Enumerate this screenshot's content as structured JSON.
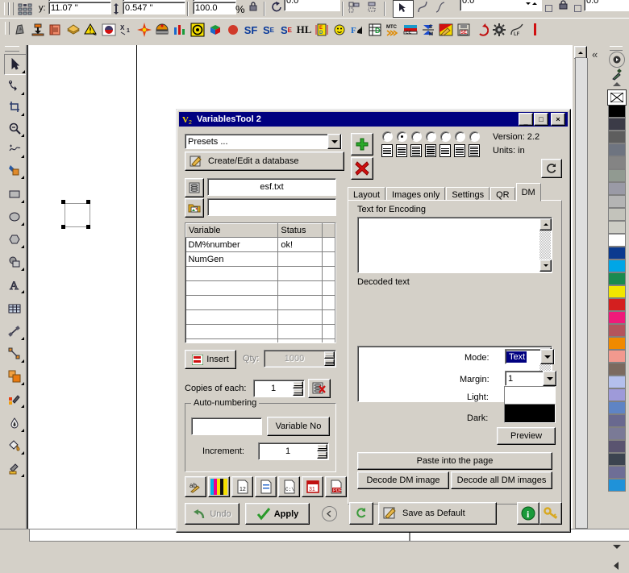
{
  "propertybar": {
    "y_label": "y:",
    "y_value": "11.07 \"",
    "height_value": "0.547 \"",
    "scale_value": "100.0",
    "percent_label": "%",
    "rotate_value": "0.0",
    "outline_value": "0.0 \"",
    "nudge_value": "0.0 \"",
    "icons": [
      "position-grid-icon",
      "height-icon",
      "lock-ratio-icon",
      "rotate-icon",
      "align-icon",
      "distribute-icon",
      "pick-tool-icon",
      "curve-icon",
      "line-icon"
    ]
  },
  "toolbar_icons": [
    "import-icon",
    "export-icon",
    "duplicate-icon",
    "package-icon",
    "warning-icon",
    "red-ball-icon",
    "transform-icon",
    "starburst-icon",
    "barcode-icon",
    "chart-icon",
    "target-icon",
    "cube-icon",
    "circle-icon",
    "sf-icon",
    "sf-grid-icon",
    "sf-mark-icon",
    "hl-icon",
    "ed-icon",
    "smiley-icon",
    "fd-icon",
    "table-d-icon",
    "mtc-icon",
    "cc-icon",
    "sm-icon",
    "pen-yellow-icon",
    "se-save-icon",
    "undo-red-icon",
    "gear-icon",
    "lf-curve-icon"
  ],
  "toolbox": [
    {
      "name": "pick-tool",
      "selected": true
    },
    {
      "name": "shape-tool",
      "selected": false
    },
    {
      "name": "crop-tool",
      "selected": false
    },
    {
      "name": "zoom-tool",
      "selected": false
    },
    {
      "name": "freehand-tool",
      "selected": false
    },
    {
      "name": "smart-fill-tool",
      "selected": false
    },
    {
      "name": "rectangle-tool",
      "selected": false
    },
    {
      "name": "ellipse-tool",
      "selected": false
    },
    {
      "name": "polygon-tool",
      "selected": false
    },
    {
      "name": "shapes-tool",
      "selected": false
    },
    {
      "name": "text-tool",
      "selected": false
    },
    {
      "name": "table-tool",
      "selected": false
    },
    {
      "name": "dimension-tool",
      "selected": false
    },
    {
      "name": "connector-tool",
      "selected": false
    },
    {
      "name": "blend-tool",
      "selected": false
    },
    {
      "name": "color-eyedropper-tool",
      "selected": false
    },
    {
      "name": "outline-tool",
      "selected": false
    },
    {
      "name": "fill-tool",
      "selected": false
    },
    {
      "name": "interactive-fill-tool",
      "selected": false
    }
  ],
  "palette": {
    "none_label": "X",
    "colors": [
      "#000000",
      "#3b3b47",
      "#5e5e5e",
      "#6e7480",
      "#848484",
      "#919a91",
      "#9a9aa6",
      "#b4b4b4",
      "#c3c3bb",
      "#cdcdc5",
      "#ffffff",
      "#0b3a8f",
      "#00a6e6",
      "#1a8a4f",
      "#f2e600",
      "#d41f1f",
      "#ef1a7a",
      "#b4545c",
      "#f08a00",
      "#f2998e",
      "#7b6a5f",
      "#b4c0ec",
      "#9e9ad9",
      "#5f84c4",
      "#69698f",
      "#7a7a96",
      "#5a5470",
      "#3c4450",
      "#6e6e96",
      "#1f92d9"
    ]
  },
  "dialog": {
    "title": "VariablesTool 2",
    "app_icon": "v2-icon",
    "minimize_label": "_",
    "maximize_label": "□",
    "close_label": "×",
    "presets_value": "Presets ...",
    "create_edit_label": "Create/Edit a database",
    "database_file": "esf.txt",
    "image_folder": "",
    "version_label": "Version: 2.2",
    "units_label": "Units:  in",
    "add_button": "+",
    "remove_button": "×",
    "refresh_icon": "refresh-icon",
    "layout_options_count": 7,
    "layout_selected_index": 1,
    "table": {
      "headers": [
        "Variable",
        "Status",
        ""
      ],
      "rows": [
        [
          "DM%number",
          "ok!",
          ""
        ],
        [
          "NumGen",
          "",
          ""
        ],
        [
          "",
          "",
          ""
        ],
        [
          "",
          "",
          ""
        ],
        [
          "",
          "",
          ""
        ],
        [
          "",
          "",
          ""
        ],
        [
          "",
          "",
          ""
        ],
        [
          "",
          "",
          ""
        ]
      ]
    },
    "insert_label": "Insert",
    "qty_label": "Qty:",
    "qty_value": "1000",
    "copies_label": "Copies of each:",
    "copies_value": "1",
    "clear_db_icon": "clear-database-icon",
    "autonumber_group": "Auto-numbering",
    "autonumber_value": "",
    "variable_no_label": "Variable No",
    "increment_label": "Increment:",
    "increment_value": "1",
    "footer_icons": [
      "ab-pen-icon",
      "cmyk-bars-icon",
      "number-12-icon",
      "blue-line-doc-icon",
      "csv-doc-icon",
      "calendar-31-icon",
      "pdf-doc-icon"
    ],
    "undo_label": "Undo",
    "apply_label": "Apply",
    "collapse_icon": "collapse-left-icon",
    "tabs": [
      {
        "label": "Layout",
        "active": false
      },
      {
        "label": "Images only",
        "active": false
      },
      {
        "label": "Settings",
        "active": false
      },
      {
        "label": "QR",
        "active": false
      },
      {
        "label": "DM",
        "active": true
      }
    ],
    "dm": {
      "text_for_encoding_label": "Text for Encoding",
      "text_for_encoding_value": "",
      "decoded_text_label": "Decoded text",
      "decoded_text_value": "",
      "mode_label": "Mode:",
      "mode_value": "Text",
      "margin_label": "Margin:",
      "margin_value": "1",
      "light_label": "Light:",
      "light_color": "#ffffff",
      "dark_label": "Dark:",
      "dark_color": "#000000",
      "preview_label": "Preview",
      "paste_label": "Paste into the page",
      "decode_one_label": "Decode DM image",
      "decode_all_label": "Decode all DM images"
    },
    "bottom": {
      "refresh_icon": "refresh-green-icon",
      "save_default_label": "Save as Default",
      "info_icon": "info-icon",
      "key_icon": "key-icon"
    }
  }
}
